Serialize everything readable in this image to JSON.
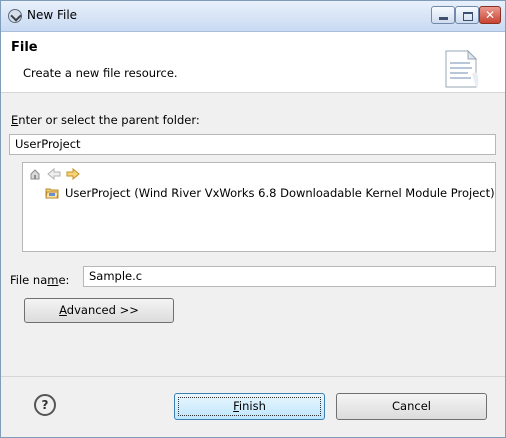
{
  "window": {
    "title": "New File"
  },
  "header": {
    "title": "File",
    "description": "Create a new file resource."
  },
  "parent_folder": {
    "label_mnemonic": "E",
    "label_rest": "nter or select the parent folder:",
    "value": "UserProject"
  },
  "tree": {
    "items": [
      {
        "label": "UserProject (Wind River VxWorks 6.8 Downloadable Kernel Module Project)"
      }
    ]
  },
  "file_name": {
    "label_pre": "File na",
    "label_mnemonic": "m",
    "label_post": "e:",
    "value": "Sample.c"
  },
  "advanced_button": {
    "mnemonic": "A",
    "rest": "dvanced >>"
  },
  "footer": {
    "help_glyph": "?",
    "finish_mnemonic": "F",
    "finish_rest": "inish",
    "cancel_label": "Cancel"
  },
  "icons": {
    "app": "eclipse-app-icon",
    "home": "home-icon",
    "back": "back-arrow-icon",
    "forward": "forward-arrow-icon",
    "project": "project-folder-icon",
    "help": "help-icon"
  }
}
